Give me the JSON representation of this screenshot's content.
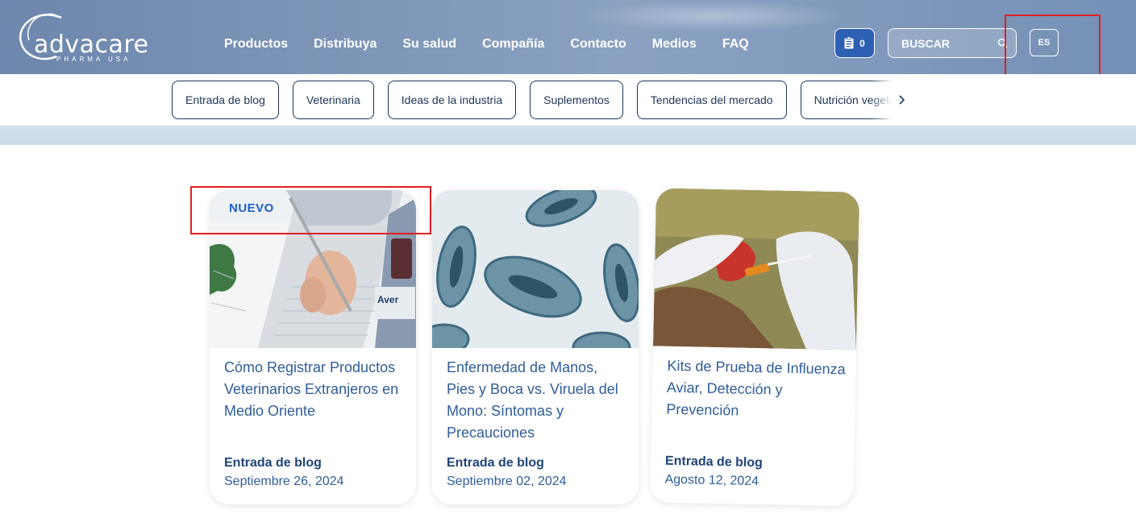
{
  "header": {
    "logo": {
      "word": "advacare",
      "sub": "PHARMA USA"
    },
    "nav": [
      "Productos",
      "Distribuya",
      "Su salud",
      "Compañía",
      "Contacto",
      "Medios",
      "FAQ"
    ],
    "cart_count": "0",
    "search_label": "BUSCAR",
    "language": "ES"
  },
  "categories": [
    "Entrada de blog",
    "Veterinaria",
    "Ideas de la industria",
    "Suplementos",
    "Tendencias del mercado",
    "Nutrición vegetal"
  ],
  "cards": [
    {
      "badge": "NUEVO",
      "title": "Cómo Registrar Productos Veterinarios Extranjeros en Medio Oriente",
      "category": "Entrada de blog",
      "date": "Septiembre 26, 2024"
    },
    {
      "title": "Enfermedad de Manos, Pies y Boca vs. Viruela del Mono: Síntomas y Precauciones",
      "category": "Entrada de blog",
      "date": "Septiembre 02, 2024"
    },
    {
      "title": "Kits de Prueba de Influenza Aviar, Detección y Prevención",
      "category": "Entrada de blog",
      "date": "Agosto 12, 2024"
    }
  ],
  "colors": {
    "header": "#7f97b9",
    "accent": "#2d5fb3",
    "title": "#2f5d9a",
    "highlight": "#e02020"
  }
}
